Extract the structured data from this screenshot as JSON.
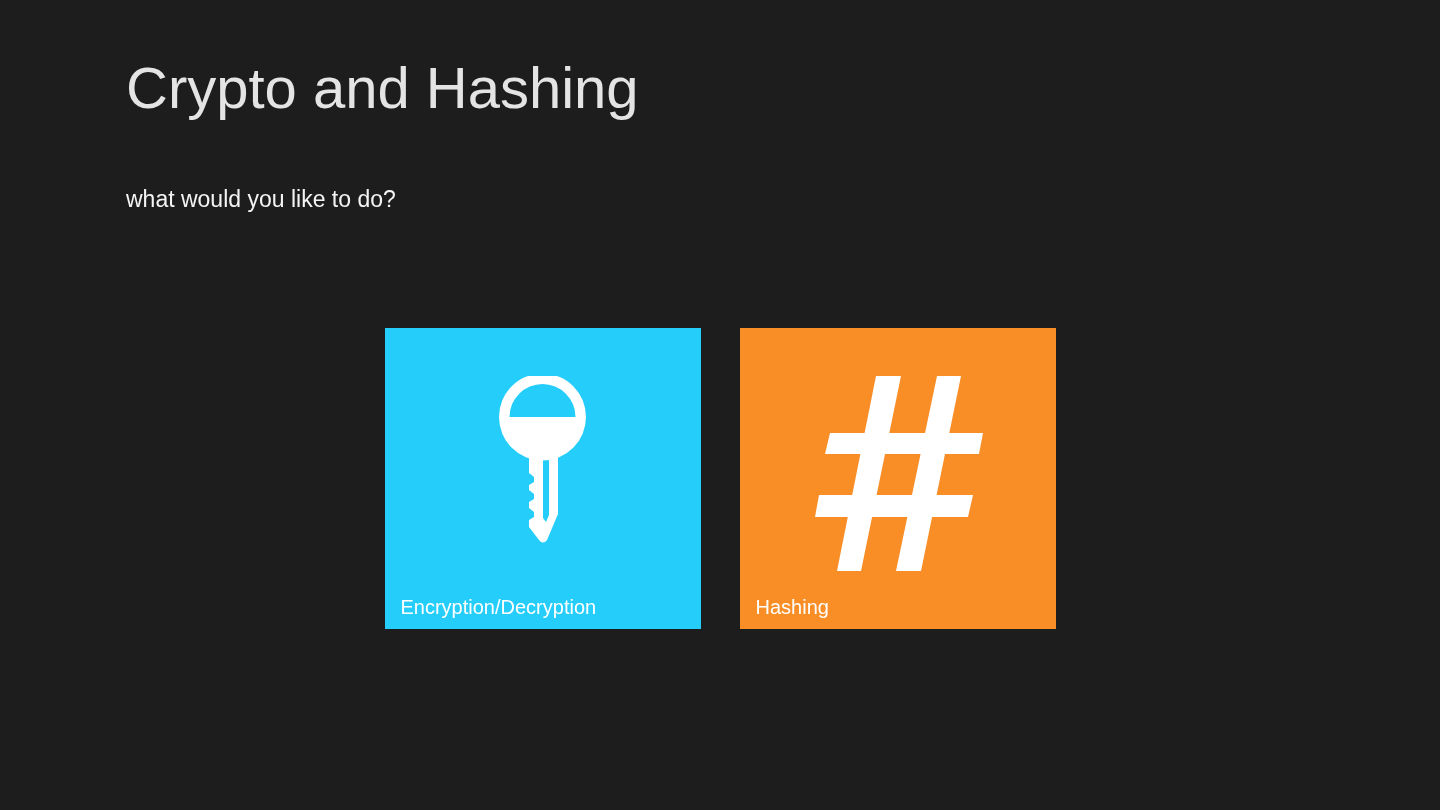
{
  "page": {
    "title": "Crypto and Hashing",
    "subtitle": "what would you like to do?"
  },
  "tiles": [
    {
      "kind": "key",
      "label": "Encryption/Decryption",
      "color": "#25cdfa"
    },
    {
      "kind": "hash",
      "label": "Hashing",
      "color": "#f98e27"
    }
  ]
}
